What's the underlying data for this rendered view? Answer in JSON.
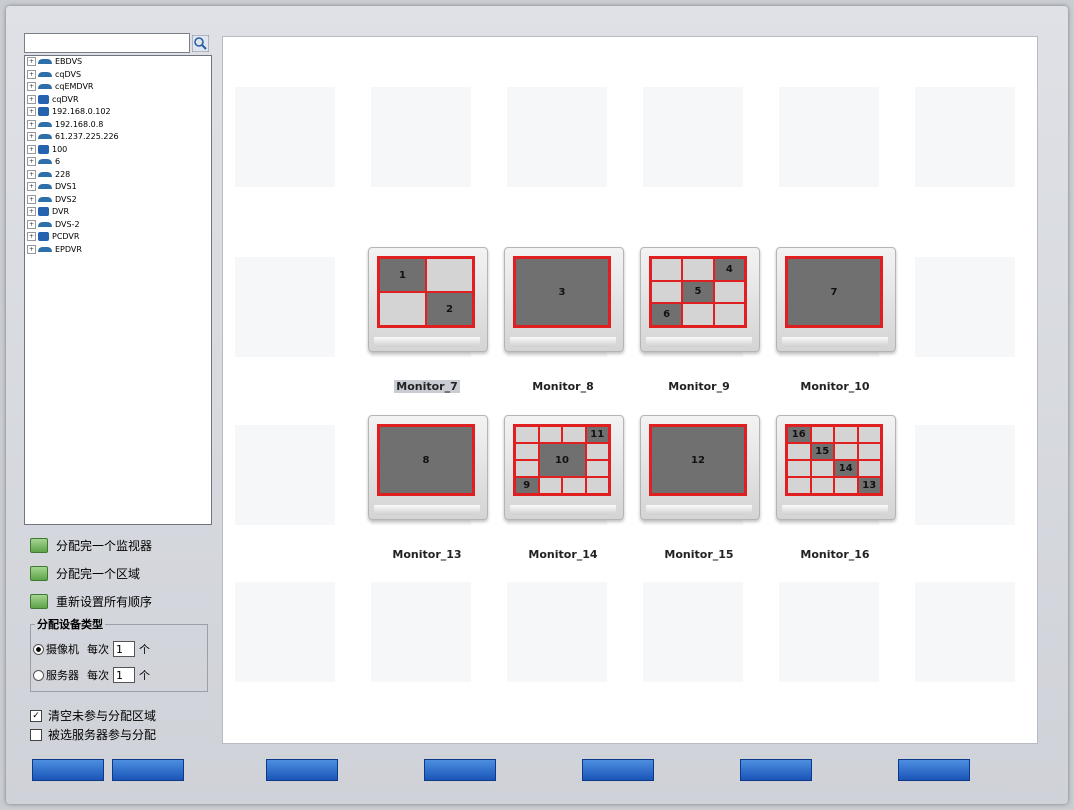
{
  "tree": {
    "items": [
      {
        "label": "EBDVS",
        "icon": "dvr-icon"
      },
      {
        "label": "cqDVS",
        "icon": "dvr-icon"
      },
      {
        "label": "cqEMDVR",
        "icon": "dvr-icon"
      },
      {
        "label": "cqDVR",
        "icon": "encoder-icon"
      },
      {
        "label": "192.168.0.102",
        "icon": "encoder-icon"
      },
      {
        "label": "192.168.0.8",
        "icon": "dvr-icon"
      },
      {
        "label": "61.237.225.226",
        "icon": "dvr-icon"
      },
      {
        "label": "100",
        "icon": "encoder-icon"
      },
      {
        "label": "6",
        "icon": "dvr-icon"
      },
      {
        "label": "228",
        "icon": "dvr-icon"
      },
      {
        "label": "DVS1",
        "icon": "dvr-icon"
      },
      {
        "label": "DVS2",
        "icon": "dvr-icon"
      },
      {
        "label": "DVR",
        "icon": "encoder-icon"
      },
      {
        "label": "DVS-2",
        "icon": "dvr-icon"
      },
      {
        "label": "PCDVR",
        "icon": "encoder-icon"
      },
      {
        "label": "EPDVR",
        "icon": "dvr-icon"
      }
    ]
  },
  "actions": {
    "assign_monitor": "分配完一个监视器",
    "assign_area": "分配完一个区域",
    "reset_order": "重新设置所有顺序"
  },
  "device_type": {
    "title": "分配设备类型",
    "camera_label": "摄像机",
    "server_label": "服务器",
    "each_label": "每次",
    "unit": "个",
    "camera_count": "1",
    "server_count": "1",
    "selected": "camera"
  },
  "options": {
    "clear_unassigned": "清空未参与分配区域",
    "clear_checked": true,
    "server_assign": "被选服务器参与分配",
    "server_checked": false
  },
  "monitors": [
    {
      "label": "Monitor_7",
      "layout": "quad",
      "cells": [
        "1",
        "",
        "",
        "2"
      ],
      "selected": true
    },
    {
      "label": "Monitor_8",
      "layout": "single",
      "cells": [
        "3"
      ]
    },
    {
      "label": "Monitor_9",
      "layout": "grid9",
      "cells": [
        "",
        "",
        "4",
        "",
        "5",
        "",
        "6",
        "",
        ""
      ]
    },
    {
      "label": "Monitor_10",
      "layout": "single",
      "cells": [
        "7"
      ]
    },
    {
      "label": "Monitor_13",
      "layout": "single",
      "cells": [
        "8"
      ]
    },
    {
      "label": "Monitor_14",
      "layout": "grid16big",
      "cells": [
        "10",
        "11",
        "9"
      ]
    },
    {
      "label": "Monitor_15",
      "layout": "single",
      "cells": [
        "12"
      ]
    },
    {
      "label": "Monitor_16",
      "layout": "grid16",
      "cells": [
        "16",
        "15",
        "14",
        "13"
      ]
    }
  ],
  "bottom_buttons": [
    "",
    "",
    "",
    "",
    "",
    "",
    ""
  ],
  "colors": {
    "accent_red": "#e02020",
    "button_blue": "#1b55b8"
  }
}
